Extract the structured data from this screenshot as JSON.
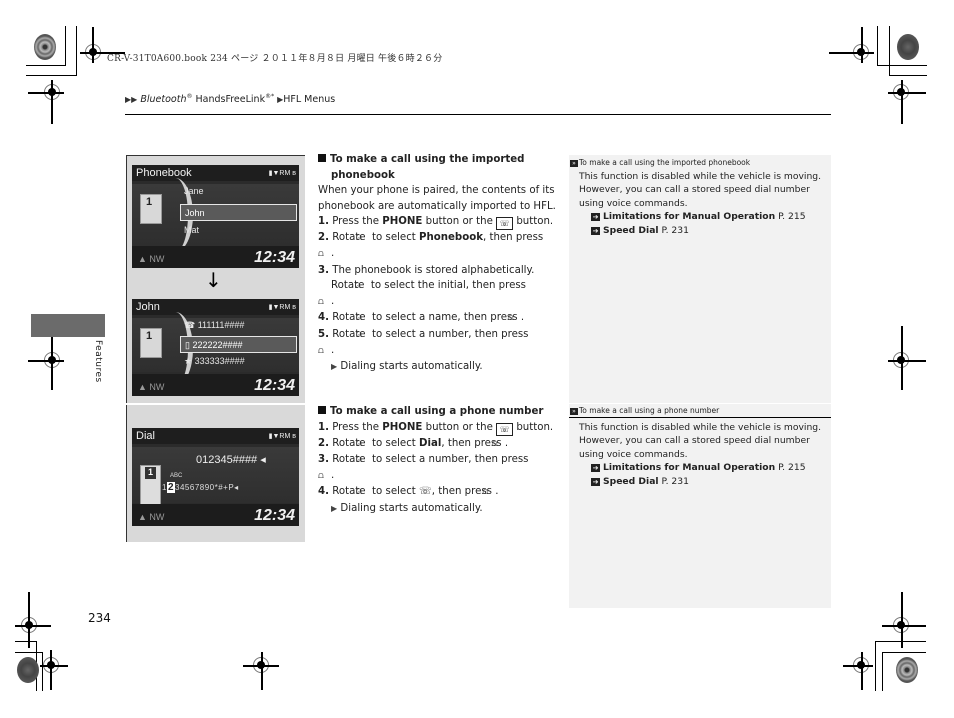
{
  "print_meta": {
    "text": "CR-V-31T0A600.book  234 ページ  ２０１１年８月８日  月曜日  午後６時２６分"
  },
  "breadcrumb": {
    "part1": "Bluetooth",
    "part1_reg": "®",
    "part2": " HandsFreeLink",
    "part2_sup": "®*",
    "part3": "HFL Menus"
  },
  "side_tab": {
    "label": "Features"
  },
  "screens": {
    "phonebook": {
      "title": "Phonebook",
      "status": "▮▼RM ʙ",
      "book_num": "1",
      "items": [
        "Jane",
        "John",
        "Mat"
      ],
      "selected_index": 1,
      "nav": "▲ NW",
      "clock": "12:34"
    },
    "arrow": "↓",
    "contact": {
      "title": "John",
      "status": "▮▼RM ʙ",
      "book_num": "1",
      "items": [
        "☎ 111111####",
        "▯ 222222####",
        "★ 333333####"
      ],
      "selected_index": 1,
      "nav": "▲ NW",
      "clock": "12:34"
    },
    "dial": {
      "title": "Dial",
      "status": "▮▼RM ʙ",
      "number": "012345#### ◂",
      "phone_num": "1",
      "abc": "ABC",
      "digit_pre": "1",
      "digit_sel": "2",
      "digit_post": "34567890*#+P◂",
      "nav": "▲ NW",
      "clock": "12:34"
    }
  },
  "section1": {
    "heading": "To make a call using the imported phonebook",
    "intro": "When your phone is paired, the contents of its phonebook are automatically imported to HFL.",
    "steps": [
      {
        "n": "1.",
        "pre": "Press the ",
        "bold": "PHONE",
        "post": " button or the ",
        "icon": "phone-button-icon",
        "end": " button."
      },
      {
        "n": "2.",
        "pre": "Rotate ",
        "mid": " to select ",
        "bold": "Phonebook",
        "post": ", then press"
      },
      {
        "n": "3.",
        "line1": "The phonebook is stored alphabetically.",
        "line2": "Rotate ",
        "line2b": " to select the initial, then press"
      },
      {
        "n": "4.",
        "pre": "Rotate ",
        "post": " to select a name, then press "
      },
      {
        "n": "5.",
        "pre": "Rotate ",
        "post": " to select a number, then press"
      }
    ],
    "result": "Dialing starts automatically."
  },
  "section2": {
    "heading": "To make a call using a phone number",
    "steps": [
      {
        "n": "1.",
        "pre": "Press the ",
        "bold": "PHONE",
        "post": " button or the ",
        "end": " button."
      },
      {
        "n": "2.",
        "pre": "Rotate ",
        "mid": " to select ",
        "bold": "Dial",
        "post": ", then press "
      },
      {
        "n": "3.",
        "pre": "Rotate ",
        "post": " to select a number, then press"
      },
      {
        "n": "4.",
        "pre": "Rotate ",
        "mid": " to select ",
        "post": ", then press "
      }
    ],
    "result": "Dialing starts automatically."
  },
  "note1": {
    "heading": "To make a call using the imported phonebook",
    "body": "This function is disabled while the vehicle is moving. However, you can call a stored speed dial number using voice commands.",
    "refs": [
      {
        "title": "Limitations for Manual Operation",
        "page": "P. 215"
      },
      {
        "title": "Speed Dial",
        "page": "P. 231"
      }
    ]
  },
  "note2": {
    "heading": "To make a call using a phone number",
    "body": "This function is disabled while the vehicle is moving. However, you can call a stored speed dial number using voice commands.",
    "refs": [
      {
        "title": "Limitations for Manual Operation",
        "page": "P. 215"
      },
      {
        "title": "Speed Dial",
        "page": "P. 231"
      }
    ]
  },
  "icons": {
    "knob": "⍝",
    "press": "⩍",
    "phone": "☏",
    "tri": "▶",
    "double_tri": "▶▶",
    "ref_arrow": "➔",
    "note_mark": "»"
  },
  "page_number": "234"
}
